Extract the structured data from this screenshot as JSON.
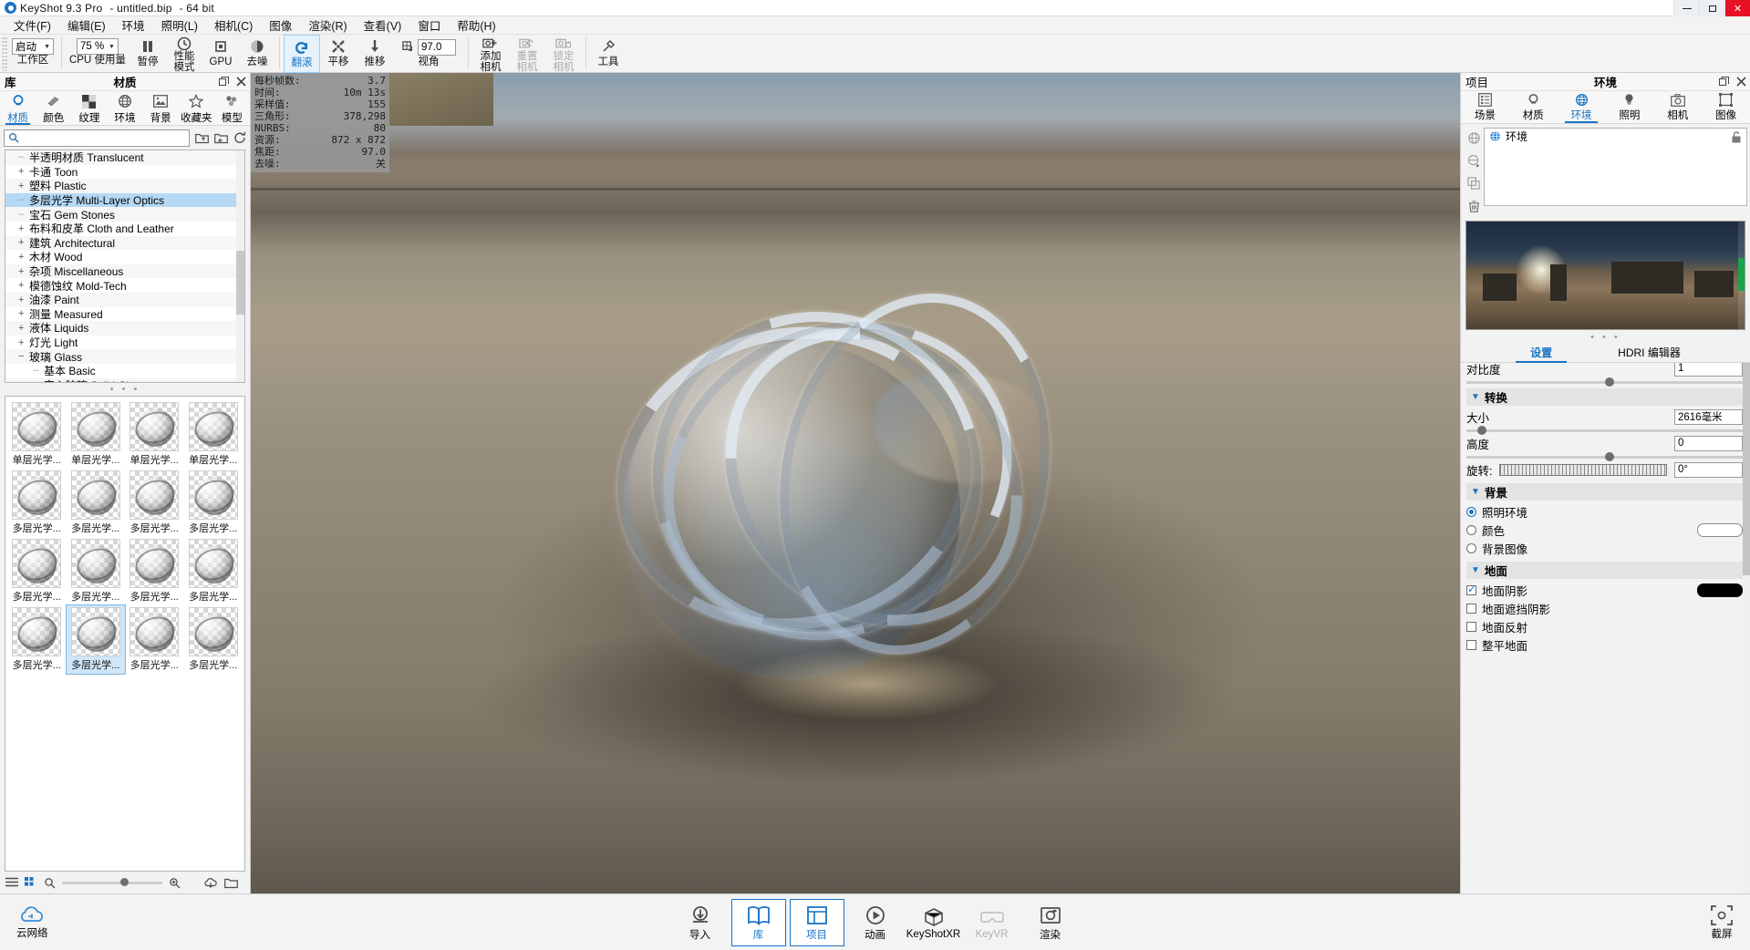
{
  "titlebar": {
    "app_name": "KeyShot 9.3 Pro",
    "file": "- untitled.bip",
    "bits": "- 64 bit",
    "minimize": "—",
    "maximize": "▢",
    "close": "✕"
  },
  "menubar": {
    "items": [
      "文件(F)",
      "编辑(E)",
      "环境",
      "照明(L)",
      "相机(C)",
      "图像",
      "渲染(R)",
      "查看(V)",
      "窗口",
      "帮助(H)"
    ]
  },
  "toolbar": {
    "workspace": {
      "label": "工作区",
      "value": "启动"
    },
    "cpu_usage": {
      "label": "CPU 使用量",
      "value": "75 %"
    },
    "pause": {
      "label": "暂停"
    },
    "performance": {
      "label": "性能",
      "label2": "模式"
    },
    "gpu": {
      "label": "GPU"
    },
    "denoise": {
      "label": "去噪"
    },
    "tumble": {
      "label": "翻滚"
    },
    "pan": {
      "label": "平移"
    },
    "dolly": {
      "label": "推移"
    },
    "fov": {
      "label": "视角",
      "value": "97.0"
    },
    "add_camera": {
      "label": "添加",
      "label2": "相机"
    },
    "reset_camera": {
      "label": "重置",
      "label2": "相机"
    },
    "lock_camera": {
      "label": "锁定",
      "label2": "相机"
    },
    "tools": {
      "label": "工具"
    }
  },
  "library": {
    "panel_left_label": "库",
    "panel_title": "材质",
    "restore_icon": "restore",
    "close_icon": "close",
    "tabs": [
      {
        "label": "材质",
        "icon": "material-icon",
        "active": true
      },
      {
        "label": "颜色",
        "icon": "color-icon",
        "active": false
      },
      {
        "label": "纹理",
        "icon": "texture-icon",
        "active": false
      },
      {
        "label": "环境",
        "icon": "environment-icon",
        "active": false
      },
      {
        "label": "背景",
        "icon": "backplate-icon",
        "active": false
      },
      {
        "label": "收藏夹",
        "icon": "star-icon",
        "active": false
      },
      {
        "label": "模型",
        "icon": "model-icon",
        "active": false
      }
    ],
    "search_placeholder": "",
    "search_value": "",
    "tree": [
      {
        "label": "半透明材质 Translucent",
        "expander": "",
        "selected": false,
        "indent": 0
      },
      {
        "label": "卡通 Toon",
        "expander": "+",
        "selected": false,
        "indent": 0
      },
      {
        "label": "塑料 Plastic",
        "expander": "+",
        "selected": false,
        "indent": 0
      },
      {
        "label": "多层光学 Multi-Layer Optics",
        "expander": "",
        "selected": true,
        "indent": 0
      },
      {
        "label": "宝石 Gem Stones",
        "expander": "",
        "selected": false,
        "indent": 0
      },
      {
        "label": "布料和皮革 Cloth and Leather",
        "expander": "+",
        "selected": false,
        "indent": 0
      },
      {
        "label": "建筑 Architectural",
        "expander": "+",
        "selected": false,
        "indent": 0
      },
      {
        "label": "木材 Wood",
        "expander": "+",
        "selected": false,
        "indent": 0
      },
      {
        "label": "杂项 Miscellaneous",
        "expander": "+",
        "selected": false,
        "indent": 0
      },
      {
        "label": "模德蚀纹 Mold-Tech",
        "expander": "+",
        "selected": false,
        "indent": 0
      },
      {
        "label": "油漆 Paint",
        "expander": "+",
        "selected": false,
        "indent": 0
      },
      {
        "label": "测量 Measured",
        "expander": "+",
        "selected": false,
        "indent": 0
      },
      {
        "label": "液体 Liquids",
        "expander": "+",
        "selected": false,
        "indent": 0
      },
      {
        "label": "灯光 Light",
        "expander": "+",
        "selected": false,
        "indent": 0
      },
      {
        "label": "玻璃 Glass",
        "expander": "−",
        "selected": false,
        "indent": 0
      },
      {
        "label": "基本 Basic",
        "expander": "",
        "selected": false,
        "indent": 1
      },
      {
        "label": "实心玻璃 Solid Glass",
        "expander": "",
        "selected": false,
        "indent": 1
      }
    ],
    "divider_dots": "• • •",
    "thumbnails": [
      {
        "caption": "单层光学...",
        "selected": false
      },
      {
        "caption": "单层光学...",
        "selected": false
      },
      {
        "caption": "单层光学...",
        "selected": false
      },
      {
        "caption": "单层光学...",
        "selected": false
      },
      {
        "caption": "多层光学...",
        "selected": false
      },
      {
        "caption": "多层光学...",
        "selected": false
      },
      {
        "caption": "多层光学...",
        "selected": false
      },
      {
        "caption": "多层光学...",
        "selected": false
      },
      {
        "caption": "多层光学...",
        "selected": false
      },
      {
        "caption": "多层光学...",
        "selected": false
      },
      {
        "caption": "多层光学...",
        "selected": false
      },
      {
        "caption": "多层光学...",
        "selected": false
      },
      {
        "caption": "多层光学...",
        "selected": false
      },
      {
        "caption": "多层光学...",
        "selected": true
      },
      {
        "caption": "多层光学...",
        "selected": false
      },
      {
        "caption": "多层光学...",
        "selected": false
      }
    ]
  },
  "hud": {
    "rows": [
      {
        "key": "每秒帧数:",
        "value": "3.7"
      },
      {
        "key": "时间:",
        "value": "10m 13s"
      },
      {
        "key": "采样值:",
        "value": "155"
      },
      {
        "key": "三角形:",
        "value": "378,298"
      },
      {
        "key": "NURBS:",
        "value": "80"
      },
      {
        "key": "资源:",
        "value": "872 x 872"
      },
      {
        "key": "焦距:",
        "value": "97.0"
      },
      {
        "key": "去噪:",
        "value": "关"
      }
    ]
  },
  "project": {
    "panel_left_label": "项目",
    "panel_title": "环境",
    "tabs": [
      {
        "label": "场景",
        "icon": "scene-icon",
        "active": false
      },
      {
        "label": "材质",
        "icon": "material-icon",
        "active": false
      },
      {
        "label": "环境",
        "icon": "environment-icon",
        "active": true
      },
      {
        "label": "照明",
        "icon": "lighting-icon",
        "active": false
      },
      {
        "label": "相机",
        "icon": "camera-icon",
        "active": false
      },
      {
        "label": "图像",
        "icon": "image-icon",
        "active": false
      }
    ],
    "side_buttons": [
      "globe-icon",
      "globe-add-icon",
      "duplicate-icon",
      "trash-icon"
    ],
    "list_items": [
      {
        "label": "环境",
        "icon": "environment-icon",
        "lock": "lock-icon"
      }
    ],
    "dots": "• • •",
    "sub_tabs": [
      {
        "label": "设置",
        "active": true
      },
      {
        "label": "HDRI 编辑器",
        "active": false
      }
    ],
    "contrast": {
      "label": "对比度",
      "value": "1"
    },
    "sections": {
      "transform": {
        "title": "转换",
        "size": {
          "label": "大小",
          "value": "2616毫米"
        },
        "height": {
          "label": "高度",
          "value": "0"
        },
        "rotation": {
          "label": "旋转:",
          "value": "0°"
        }
      },
      "background": {
        "title": "背景",
        "options": [
          {
            "label": "照明环境",
            "selected": true,
            "swatch": null
          },
          {
            "label": "颜色",
            "selected": false,
            "swatch": "#ffffff"
          },
          {
            "label": "背景图像",
            "selected": false,
            "swatch": null
          }
        ]
      },
      "ground": {
        "title": "地面",
        "options": [
          {
            "label": "地面阴影",
            "checked": true,
            "swatch": "#000000"
          },
          {
            "label": "地面遮挡阴影",
            "checked": false,
            "swatch": null
          },
          {
            "label": "地面反射",
            "checked": false,
            "swatch": null
          },
          {
            "label": "整平地面",
            "checked": false,
            "swatch": null
          }
        ]
      }
    }
  },
  "bottombar": {
    "cloud": {
      "label": "云网络",
      "icon": "cloud-icon"
    },
    "items": [
      {
        "label": "导入",
        "icon": "import-icon",
        "active": false,
        "dim": false
      },
      {
        "label": "库",
        "icon": "library-icon",
        "active": true,
        "dim": false
      },
      {
        "label": "项目",
        "icon": "project-icon",
        "active": true,
        "dim": false
      },
      {
        "label": "动画",
        "icon": "animation-icon",
        "active": false,
        "dim": false
      },
      {
        "label": "KeyShotXR",
        "icon": "xr-icon",
        "active": false,
        "dim": false
      },
      {
        "label": "KeyVR",
        "icon": "keyvr-icon",
        "active": false,
        "dim": true
      },
      {
        "label": "渲染",
        "icon": "render-icon",
        "active": false,
        "dim": false
      }
    ],
    "screenshot": {
      "label": "截屏",
      "icon": "screenshot-icon"
    }
  },
  "colors": {
    "accent": "#1a74c4",
    "selection": "#b5d9f5",
    "close_red": "#e81123",
    "panel_bg": "#f2f2f2"
  }
}
